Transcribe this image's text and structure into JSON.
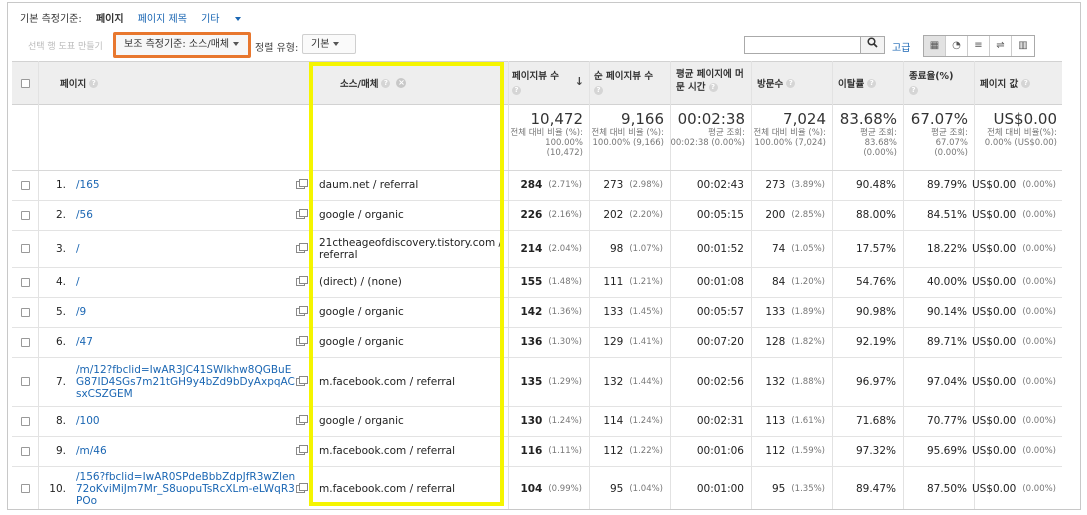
{
  "topbar": {
    "primary_dim_label": "기본 측정기준:",
    "primary_dim_value": "페이지",
    "page_title_link": "페이지 제목",
    "other_link": "기타"
  },
  "toolbar": {
    "faded_text": "선택 행 도표 만들기",
    "secondary_dim": "보조 측정기준: 소스/매체",
    "sort_label": "정렬 유형:",
    "sort_value": "기본",
    "search_value": "",
    "advanced": "고급"
  },
  "columns": {
    "page": "페이지",
    "source_medium": "소스/매체",
    "pageviews": "페이지뷰 수",
    "unique_pageviews": "순 페이지뷰 수",
    "avg_time": "평균 페이지에 머문 시간",
    "sessions": "방문수",
    "bounce_rate": "이탈률",
    "exit_rate": "종료율(%)",
    "page_value": "페이지 값"
  },
  "totals": {
    "pageviews": {
      "value": "10,472",
      "sub": "전체 대비 비율 (%): 100.00% (10,472)"
    },
    "unique_pageviews": {
      "value": "9,166",
      "sub": "전체 대비 비율 (%): 100.00% (9,166)"
    },
    "avg_time": {
      "value": "00:02:38",
      "sub": "평균 조회: 00:02:38 (0.00%)"
    },
    "sessions": {
      "value": "7,024",
      "sub": "전체 대비 비율 (%): 100.00% (7,024)"
    },
    "bounce_rate": {
      "value": "83.68%",
      "sub": "평균 조회: 83.68% (0.00%)"
    },
    "exit_rate": {
      "value": "67.07%",
      "sub": "평균 조회: 67.07% (0.00%)"
    },
    "page_value": {
      "value": "US$0.00",
      "sub": "전체 대비 비율(%): 0.00% (US$0.00)"
    }
  },
  "rows": [
    {
      "n": "1.",
      "page": "/165",
      "source": "daum.net / referral",
      "pv": "284",
      "pv_pct": "(2.71%)",
      "upv": "273",
      "upv_pct": "(2.98%)",
      "time": "00:02:43",
      "ses": "273",
      "ses_pct": "(3.89%)",
      "bounce": "90.48%",
      "exit": "89.79%",
      "val": "US$0.00",
      "val_pct": "(0.00%)"
    },
    {
      "n": "2.",
      "page": "/56",
      "source": "google / organic",
      "pv": "226",
      "pv_pct": "(2.16%)",
      "upv": "202",
      "upv_pct": "(2.20%)",
      "time": "00:05:15",
      "ses": "200",
      "ses_pct": "(2.85%)",
      "bounce": "88.00%",
      "exit": "84.51%",
      "val": "US$0.00",
      "val_pct": "(0.00%)"
    },
    {
      "n": "3.",
      "page": "/",
      "source": "21ctheageofdiscovery.tistory.com / referral",
      "pv": "214",
      "pv_pct": "(2.04%)",
      "upv": "98",
      "upv_pct": "(1.07%)",
      "time": "00:01:52",
      "ses": "74",
      "ses_pct": "(1.05%)",
      "bounce": "17.57%",
      "exit": "18.22%",
      "val": "US$0.00",
      "val_pct": "(0.00%)"
    },
    {
      "n": "4.",
      "page": "/",
      "source": "(direct) / (none)",
      "pv": "155",
      "pv_pct": "(1.48%)",
      "upv": "111",
      "upv_pct": "(1.21%)",
      "time": "00:01:08",
      "ses": "84",
      "ses_pct": "(1.20%)",
      "bounce": "54.76%",
      "exit": "40.00%",
      "val": "US$0.00",
      "val_pct": "(0.00%)"
    },
    {
      "n": "5.",
      "page": "/9",
      "source": "google / organic",
      "pv": "142",
      "pv_pct": "(1.36%)",
      "upv": "133",
      "upv_pct": "(1.45%)",
      "time": "00:05:57",
      "ses": "133",
      "ses_pct": "(1.89%)",
      "bounce": "90.98%",
      "exit": "90.14%",
      "val": "US$0.00",
      "val_pct": "(0.00%)"
    },
    {
      "n": "6.",
      "page": "/47",
      "source": "google / organic",
      "pv": "136",
      "pv_pct": "(1.30%)",
      "upv": "129",
      "upv_pct": "(1.41%)",
      "time": "00:07:20",
      "ses": "128",
      "ses_pct": "(1.82%)",
      "bounce": "92.19%",
      "exit": "89.71%",
      "val": "US$0.00",
      "val_pct": "(0.00%)"
    },
    {
      "n": "7.",
      "page": "/m/12?fbclid=IwAR3JC41SWIkhw8QGBuEG87ID4SGs7m21tGH9y4bZd9bDyAxpqACsxCSZGEM",
      "source": "m.facebook.com / referral",
      "pv": "135",
      "pv_pct": "(1.29%)",
      "upv": "132",
      "upv_pct": "(1.44%)",
      "time": "00:02:56",
      "ses": "132",
      "ses_pct": "(1.88%)",
      "bounce": "96.97%",
      "exit": "97.04%",
      "val": "US$0.00",
      "val_pct": "(0.00%)"
    },
    {
      "n": "8.",
      "page": "/100",
      "source": "google / organic",
      "pv": "130",
      "pv_pct": "(1.24%)",
      "upv": "114",
      "upv_pct": "(1.24%)",
      "time": "00:02:31",
      "ses": "113",
      "ses_pct": "(1.61%)",
      "bounce": "71.68%",
      "exit": "70.77%",
      "val": "US$0.00",
      "val_pct": "(0.00%)"
    },
    {
      "n": "9.",
      "page": "/m/46",
      "source": "m.facebook.com / referral",
      "pv": "116",
      "pv_pct": "(1.11%)",
      "upv": "112",
      "upv_pct": "(1.22%)",
      "time": "00:01:06",
      "ses": "112",
      "ses_pct": "(1.59%)",
      "bounce": "97.32%",
      "exit": "95.69%",
      "val": "US$0.00",
      "val_pct": "(0.00%)"
    },
    {
      "n": "10.",
      "page": "/156?fbclid=IwAR0SPdeBbbZdpJfR3wZlen72oKviMiJm7Mr_S8uopuTsRcXLm-eLWqR3POo",
      "source": "m.facebook.com / referral",
      "pv": "104",
      "pv_pct": "(0.99%)",
      "upv": "95",
      "upv_pct": "(1.04%)",
      "time": "00:01:00",
      "ses": "95",
      "ses_pct": "(1.35%)",
      "bounce": "89.47%",
      "exit": "87.50%",
      "val": "US$0.00",
      "val_pct": "(0.00%)"
    }
  ],
  "colors": {
    "highlight": "#f5f500",
    "orange_box": "#e8772e",
    "link": "#1a66b3"
  }
}
